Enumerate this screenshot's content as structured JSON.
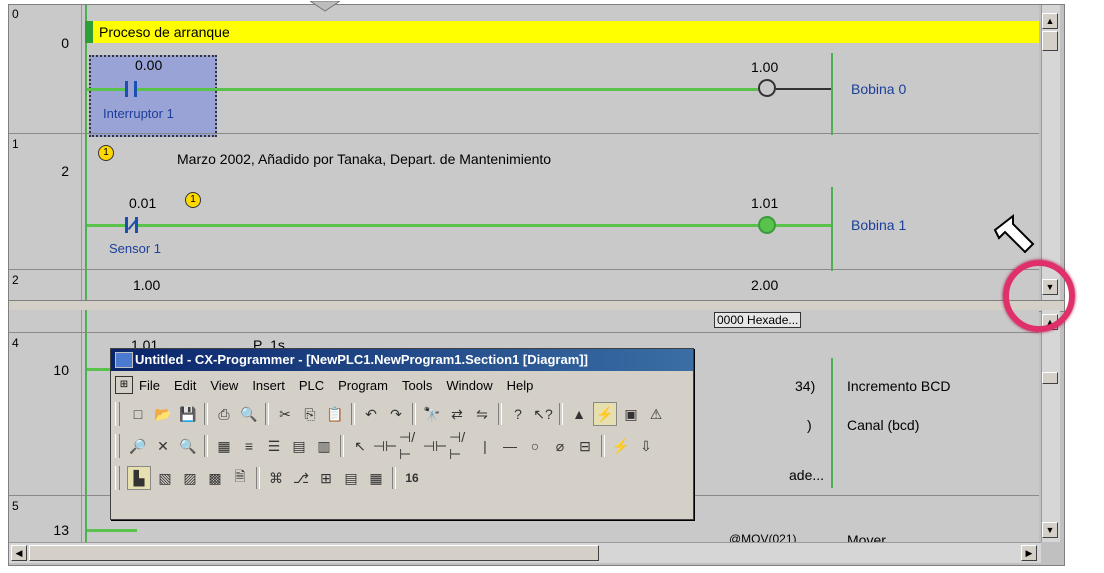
{
  "top_pane": {
    "rungs": [
      {
        "rung": "0",
        "step": "0",
        "comment": "Proceso de arranque",
        "contact": {
          "address": "0.00",
          "name": "Interruptor 1"
        },
        "coil": {
          "address": "1.00",
          "name": "Bobina 0"
        }
      },
      {
        "rung": "1",
        "step": "2",
        "comment_marker": "1",
        "comment": "Marzo 2002, Añadido por Tanaka, Depart. de Mantenimiento",
        "contact": {
          "address": "0.01",
          "name": "Sensor 1",
          "marker": "1"
        },
        "coil": {
          "address": "1.01",
          "name": "Bobina 1"
        }
      },
      {
        "rung": "2",
        "contact": {
          "address": "1.00"
        },
        "coil": {
          "address": "2.00"
        }
      }
    ]
  },
  "bottom_pane": {
    "hex_fragment": "0000 Hexade...",
    "rungs": [
      {
        "rung": "4",
        "step": "10",
        "addr1": "1.01",
        "addr2": "P_1s",
        "frag_right": "34)",
        "out1": "Incremento BCD",
        "frag_right2": ")",
        "out2": "Canal (bcd)",
        "frag_hex": "ade..."
      },
      {
        "rung": "5",
        "step": "13",
        "frag_bottom": "@MOV(021)",
        "out3": "Mover"
      }
    ]
  },
  "cx_window": {
    "title": "Untitled - CX-Programmer - [NewPLC1.NewProgram1.Section1 [Diagram]]",
    "menu": [
      "File",
      "Edit",
      "View",
      "Insert",
      "PLC",
      "Program",
      "Tools",
      "Window",
      "Help"
    ],
    "toolbar1_icons": [
      "new-icon",
      "open-icon",
      "save-icon",
      "print-icon",
      "print-preview-icon",
      "cut-icon",
      "copy-icon",
      "paste-icon",
      "undo-icon",
      "redo-icon",
      "find-icon",
      "replace-icon",
      "find-replace-icon",
      "help-icon",
      "context-help-icon",
      "warning-icon",
      "online-icon",
      "monitor-icon",
      "compile-icon"
    ],
    "toolbar3_label": "16"
  },
  "colors": {
    "comment_bar": "#ffff00",
    "wire": "#58c24a",
    "selection": "#9aa3d6",
    "titlebar": "#0a246a",
    "highlight_ring": "#e0306a"
  }
}
